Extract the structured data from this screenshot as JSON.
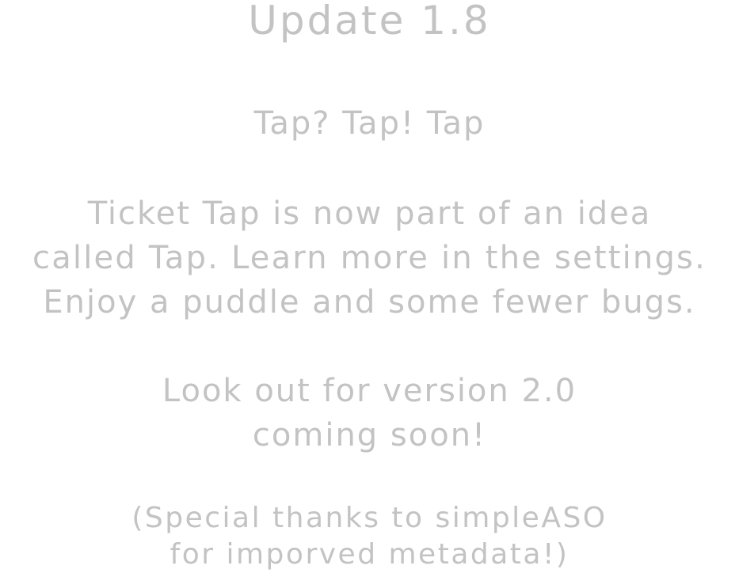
{
  "update": {
    "title": "Update 1.8",
    "subtitle": "Tap? Tap! Tap",
    "body_lines": [
      "Ticket Tap is now part of an idea",
      "called Tap. Learn more in the settings.",
      "Enjoy a puddle and some fewer bugs."
    ],
    "announcement_lines": [
      "Look out for version 2.0",
      "coming soon!"
    ],
    "note_lines": [
      "(Special thanks to simpleASO",
      "for imporved metadata!)"
    ]
  },
  "colors": {
    "background": "#ffffff",
    "text": "#c3c3c3"
  }
}
